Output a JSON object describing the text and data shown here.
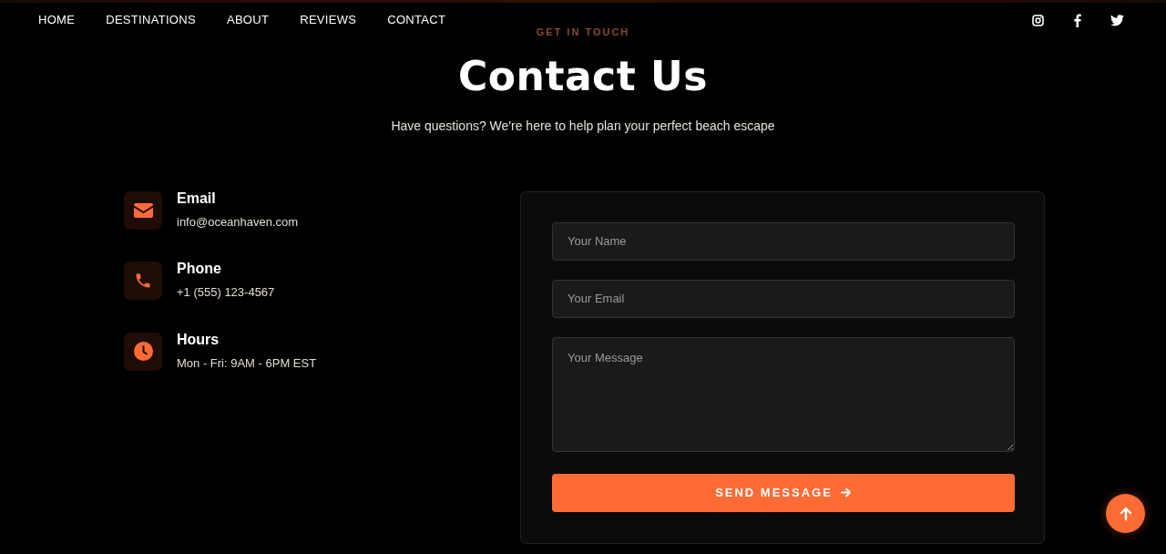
{
  "nav": {
    "links": [
      {
        "label": "HOME"
      },
      {
        "label": "DESTINATIONS"
      },
      {
        "label": "ABOUT"
      },
      {
        "label": "REVIEWS"
      },
      {
        "label": "CONTACT"
      }
    ],
    "social": [
      {
        "kind": "instagram"
      },
      {
        "kind": "facebook"
      },
      {
        "kind": "twitter"
      }
    ]
  },
  "eyebrow": "GET IN TOUCH",
  "title": "Contact Us",
  "subtitle": "Have questions? We're here to help plan your perfect beach escape",
  "contact_items": [
    {
      "kind": "email",
      "label": "Email",
      "value": "info@oceanhaven.com"
    },
    {
      "kind": "phone",
      "label": "Phone",
      "value": "+1 (555) 123-4567"
    },
    {
      "kind": "hours",
      "label": "Hours",
      "value": "Mon - Fri: 9AM - 6PM EST"
    }
  ],
  "form": {
    "fields": [
      {
        "kind": "input",
        "placeholder": "Your Name"
      },
      {
        "kind": "input",
        "placeholder": "Your Email"
      },
      {
        "kind": "textarea",
        "placeholder": "Your Message"
      }
    ],
    "submit": "SEND MESSAGE"
  }
}
